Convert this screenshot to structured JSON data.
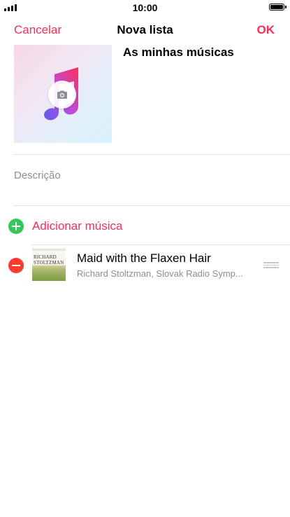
{
  "status_bar": {
    "time": "10:00"
  },
  "nav": {
    "cancel_label": "Cancelar",
    "title": "Nova lista",
    "ok_label": "OK"
  },
  "playlist": {
    "name": "As minhas músicas",
    "description_placeholder": "Descrição"
  },
  "add_music_label": "Adicionar música",
  "songs": [
    {
      "title": "Maid with the Flaxen Hair",
      "artist": "Richard Stoltzman, Slovak Radio Symp...",
      "art_lines": [
        "RICHARD",
        "STOLTZMAN"
      ]
    }
  ],
  "colors": {
    "accent": "#ff2d55",
    "add_green": "#34c759",
    "remove_red": "#ff3b30",
    "secondary_text": "#8e8e93"
  },
  "icons": [
    "signal-icon",
    "battery-icon",
    "music-note-icon",
    "camera-icon",
    "plus-icon",
    "minus-icon",
    "reorder-icon"
  ]
}
